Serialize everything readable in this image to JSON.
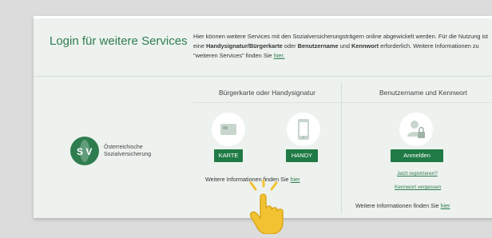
{
  "login": {
    "title": "Login für weitere Services",
    "intro_p1": "Hier können weitere Services mit den Sozialversicherungsträgern online abgewickelt werden. Für die Nutzung ist eine ",
    "intro_b1": "Handysignatur/Bürgerkarte",
    "intro_p2": " oder ",
    "intro_b2": "Benutzername",
    "intro_p3": " und ",
    "intro_b3": "Kennwort",
    "intro_p4": " erforderlich. Weitere Informationen zu \"weiteren Services\" finden Sie ",
    "intro_link": "hier."
  },
  "logo": {
    "letters": "S V",
    "line1": "Österreichische",
    "line2": "Sozialversicherung"
  },
  "signature": {
    "heading": "Bürgerkarte oder Handysignatur",
    "karte_button": "KARTE",
    "handy_button": "HANDY",
    "info_text": "Weitere Informationen finden Sie ",
    "info_link": "hier"
  },
  "credentials": {
    "heading": "Benutzername und Kennwort",
    "login_button": "Anmelden",
    "register_link": "Jetzt registrieren?",
    "forgot_link": "Kennwort vergessen",
    "info_text": "Weitere Informationen finden Sie ",
    "info_link": "hier"
  },
  "colors": {
    "brand_green": "#2e7d4f",
    "button_green": "#1f7a45",
    "hand_yellow": "#f2c233"
  }
}
